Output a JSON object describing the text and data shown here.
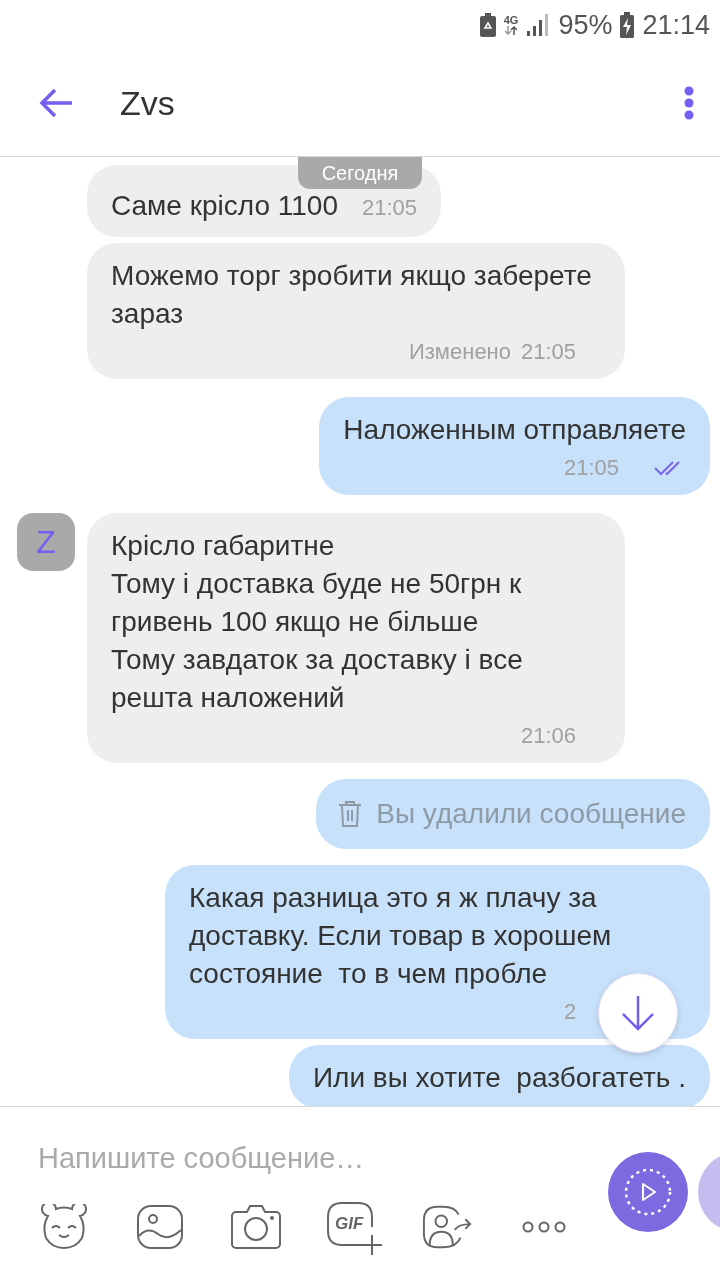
{
  "status_bar": {
    "network": "4G",
    "battery": "95%",
    "time": "21:14"
  },
  "header": {
    "title": "Zvs"
  },
  "date_badge": "Сегодня",
  "messages": [
    {
      "kind": "incoming",
      "text": "Саме крісло 1100",
      "time": "21:05"
    },
    {
      "kind": "incoming",
      "text": "Можемо торг зробити якщо заберете зараз",
      "edited": "Изменено",
      "time": "21:05"
    },
    {
      "kind": "outgoing",
      "text": "Наложенным отправляете",
      "time": "21:05",
      "read": true
    },
    {
      "kind": "incoming",
      "avatar": "Z",
      "text": "Крісло габаритне\nТому і доставка буде не 50грн к гривень 100 якщо не більше\nТому завдаток за доставку і все решта наложений",
      "time": "21:06"
    },
    {
      "kind": "deleted",
      "text": "Вы удалили сообщение"
    },
    {
      "kind": "outgoing",
      "text": "Какая разница это я ж плачу за доставку. Если товар в хорошем состояние  то в чем пробле",
      "time": "2"
    },
    {
      "kind": "outgoing",
      "text": "Или вы хотите  разбогатеть ."
    }
  ],
  "composer": {
    "placeholder": "Напишите сообщение…",
    "gif_label": "GIF"
  }
}
